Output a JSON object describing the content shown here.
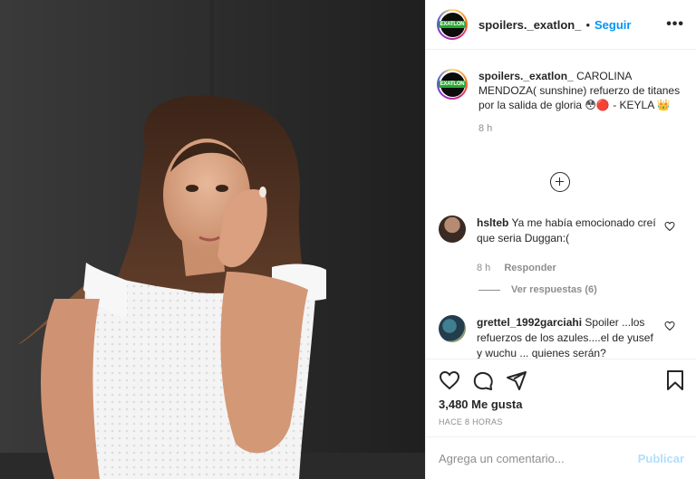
{
  "post": {
    "username": "spoilers._exatlon_",
    "avatar_text": "EXATLON",
    "follow_label": "Seguir",
    "more_label": "•••"
  },
  "caption": {
    "username": "spoilers._exatlon_",
    "text": "CAROLINA MENDOZA( sunshine) refuerzo de titanes por la salida de gloria 😳🔴 - KEYLA 👑",
    "time": "8 h"
  },
  "comments": [
    {
      "username": "hslteb",
      "text": "Ya me había emocionado creí que seria Duggan:(",
      "time": "8 h",
      "reply_label": "Responder",
      "view_replies": "Ver respuestas (6)"
    },
    {
      "username": "grettel_1992garciahi",
      "text": "Spoiler ...los refuerzos de los azules....el de yusef y wuchu ... quienes serán?"
    }
  ],
  "actions": {
    "icons": [
      "heart-icon",
      "comment-icon",
      "share-icon",
      "bookmark-icon"
    ],
    "likes": "3,480 Me gusta",
    "timestamp": "HACE 8 HORAS"
  },
  "add_comment": {
    "placeholder": "Agrega un comentario...",
    "publish_label": "Publicar"
  },
  "colors": {
    "accent": "#0095f6",
    "publish_disabled": "#b2dffc",
    "text": "#262626",
    "muted": "#8e8e8e"
  }
}
